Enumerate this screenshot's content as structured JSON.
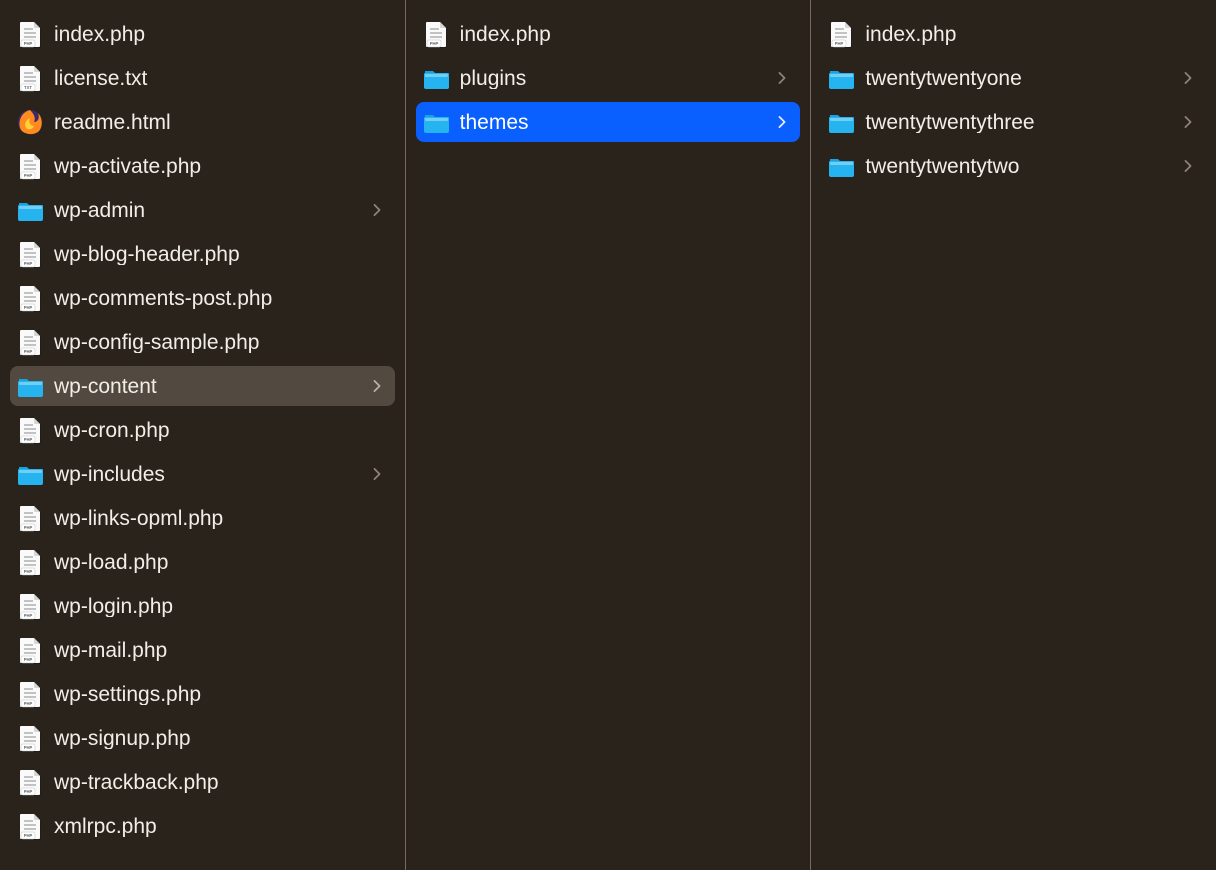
{
  "columns": [
    {
      "id": "root",
      "items": [
        {
          "name": "index.php",
          "type": "php",
          "folder": false
        },
        {
          "name": "license.txt",
          "type": "txt",
          "folder": false
        },
        {
          "name": "readme.html",
          "type": "html",
          "folder": false
        },
        {
          "name": "wp-activate.php",
          "type": "php",
          "folder": false
        },
        {
          "name": "wp-admin",
          "type": "folder",
          "folder": true
        },
        {
          "name": "wp-blog-header.php",
          "type": "php",
          "folder": false
        },
        {
          "name": "wp-comments-post.php",
          "type": "php",
          "folder": false
        },
        {
          "name": "wp-config-sample.php",
          "type": "php",
          "folder": false
        },
        {
          "name": "wp-content",
          "type": "folder",
          "folder": true,
          "state": "active"
        },
        {
          "name": "wp-cron.php",
          "type": "php",
          "folder": false
        },
        {
          "name": "wp-includes",
          "type": "folder",
          "folder": true
        },
        {
          "name": "wp-links-opml.php",
          "type": "php",
          "folder": false
        },
        {
          "name": "wp-load.php",
          "type": "php",
          "folder": false
        },
        {
          "name": "wp-login.php",
          "type": "php",
          "folder": false
        },
        {
          "name": "wp-mail.php",
          "type": "php",
          "folder": false
        },
        {
          "name": "wp-settings.php",
          "type": "php",
          "folder": false
        },
        {
          "name": "wp-signup.php",
          "type": "php",
          "folder": false
        },
        {
          "name": "wp-trackback.php",
          "type": "php",
          "folder": false
        },
        {
          "name": "xmlrpc.php",
          "type": "php",
          "folder": false
        }
      ]
    },
    {
      "id": "wp-content",
      "items": [
        {
          "name": "index.php",
          "type": "php",
          "folder": false
        },
        {
          "name": "plugins",
          "type": "folder",
          "folder": true
        },
        {
          "name": "themes",
          "type": "folder",
          "folder": true,
          "state": "selected"
        }
      ]
    },
    {
      "id": "themes",
      "items": [
        {
          "name": "index.php",
          "type": "php",
          "folder": false
        },
        {
          "name": "twentytwentyone",
          "type": "folder",
          "folder": true
        },
        {
          "name": "twentytwentythree",
          "type": "folder",
          "folder": true
        },
        {
          "name": "twentytwentytwo",
          "type": "folder",
          "folder": true
        }
      ]
    }
  ]
}
